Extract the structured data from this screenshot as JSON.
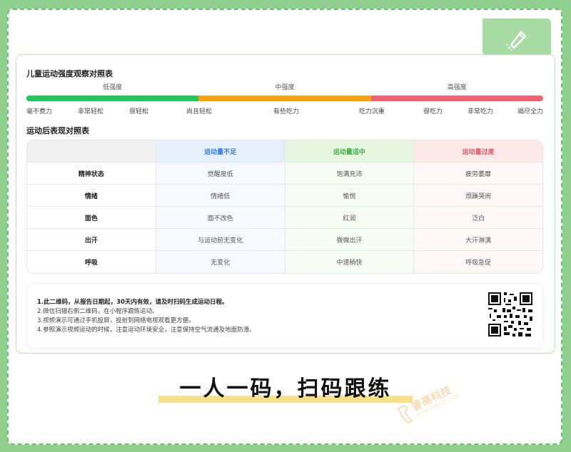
{
  "intensity": {
    "title": "儿童运动强度观察对照表",
    "levels": [
      "低强度",
      "中强度",
      "高强度"
    ],
    "ticks": [
      "毫不费力",
      "非常轻松",
      "很轻松",
      "尚且轻松",
      "有些吃力",
      "吃力沉重",
      "很吃力",
      "非常吃力",
      "竭尽全力"
    ],
    "colors": [
      "#22c55e",
      "#f5a20f",
      "#f06472"
    ]
  },
  "performance": {
    "title": "运动后表现对照表",
    "headers": [
      "",
      "运动量不足",
      "运动量适中",
      "运动量过度"
    ],
    "rows": [
      {
        "label": "精神状态",
        "values": [
          "觉醒度低",
          "饱满充沛",
          "疲劳萎靡"
        ]
      },
      {
        "label": "情绪",
        "values": [
          "情绪低",
          "愉悦",
          "烦躁哭闹"
        ]
      },
      {
        "label": "面色",
        "values": [
          "面不改色",
          "红润",
          "泛白"
        ]
      },
      {
        "label": "出汗",
        "values": [
          "与运动前无变化",
          "微微出汗",
          "大汗淋漓"
        ]
      },
      {
        "label": "呼吸",
        "values": [
          "无变化",
          "中速稍快",
          "呼吸急促"
        ]
      }
    ]
  },
  "notes": [
    "1.此二维码，从报告日期起，30天内有效，请及时扫码生成运动日程。",
    "2.微信扫描右侧二维码，在小程序跟练运动。",
    "3.视频演示可通过手机投屏，投射到网络电视观看更方便。",
    "4.参照演示视频运动的时候，注意运动环境安全，注意保持空气流通及地面防滑。"
  ],
  "slogan": "一人一码，扫码跟练",
  "watermark": {
    "brand": "睿高科技",
    "sub": "RUIGAOKEJI.COM"
  },
  "icons": {
    "corner": "pen-icon",
    "qr": "qr-code-icon"
  }
}
